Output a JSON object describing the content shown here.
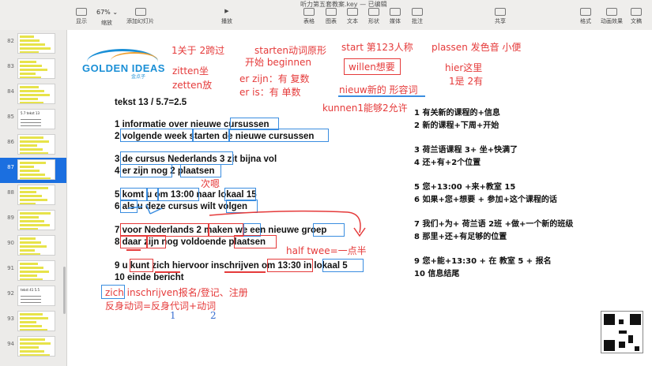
{
  "toolbar": {
    "title": "听力第五套教案.key — 已编辑",
    "zoom": "67%",
    "items": [
      {
        "label": "显示",
        "icon": "sidebar-icon"
      },
      {
        "label": "缩放",
        "icon": "zoom-icon"
      },
      {
        "label": "添加幻灯片",
        "icon": "add-slide-icon"
      },
      {
        "label": "播放",
        "icon": "play-icon"
      },
      {
        "label": "表格",
        "icon": "table-icon"
      },
      {
        "label": "图表",
        "icon": "chart-icon"
      },
      {
        "label": "文本",
        "icon": "text-icon"
      },
      {
        "label": "形状",
        "icon": "shape-icon"
      },
      {
        "label": "媒体",
        "icon": "media-icon"
      },
      {
        "label": "批注",
        "icon": "comment-icon"
      },
      {
        "label": "共享",
        "icon": "share-icon"
      },
      {
        "label": "格式",
        "icon": "format-icon"
      },
      {
        "label": "动画效果",
        "icon": "animate-icon"
      },
      {
        "label": "文稿",
        "icon": "document-icon"
      }
    ]
  },
  "sidebar": {
    "slides": [
      {
        "num": "82"
      },
      {
        "num": "83"
      },
      {
        "num": "84"
      },
      {
        "num": "85"
      },
      {
        "num": "86"
      },
      {
        "num": "87"
      },
      {
        "num": "88"
      },
      {
        "num": "89"
      },
      {
        "num": "90"
      },
      {
        "num": "91"
      },
      {
        "num": "92"
      },
      {
        "num": "93"
      },
      {
        "num": "94"
      }
    ],
    "thumb_texts": {
      "85": "5.7 tekst 13",
      "92": "tekst 41 5.5"
    },
    "active": "87"
  },
  "slide": {
    "logo": {
      "brand": "GOLDEN IDEAS",
      "sub": "金点子"
    },
    "title": "tekst 13 / 5.7=2.5",
    "lines": [
      "1 informatie over nieuwe cursussen",
      "2 volgende week starten de nieuwe cursussen",
      "3 de cursus Nederlands 3 zit bijna vol",
      "4 er zijn nog 2 plaatsen",
      "5 komt u om 13:00 naar lokaal 15",
      "6 als u deze cursus wilt volgen",
      "7 voor Nederlands 2 maken we een nieuwe groep",
      "8 daar zijn nog voldoende plaatsen",
      "9 u kunt zich hiervoor inschrijven om 13:30 in lokaal 5",
      "10  einde bericht"
    ],
    "translations": [
      "1 有关新的课程的+信息",
      "2 新的课程+下周+开始",
      "3 荷兰语课程 3+ 坐+快满了",
      "4 还+有+2个位置",
      "5 您+13:00 +来+教室 15",
      "6 如果+您+想要 + 参加+这个课程的话",
      "7 我们+为+ 荷兰语 2班 +做+一个新的班级",
      "8 那里+还+有足够的位置",
      "9 您+能+13:30 + 在 教室 5 + 报名",
      "10 信息结尾"
    ],
    "notes": {
      "n1": "1关于 2跨过",
      "n2": "starten动词原形",
      "n3": "开始 beginnen",
      "n4": "start 第123人称",
      "n5": "plassen 发色音 小便",
      "n6": "willen想要",
      "n7": "hier这里",
      "n8": "1是 2有",
      "n9": "zitten坐",
      "n10": "zetten放",
      "n11": "er zijn：有 复数",
      "n12": "er is：有 单数",
      "n13": "nieuw新的 形容词",
      "n14": "kunnen1能够2允许",
      "n15": "次嗯",
      "n16": "half twee=一点半",
      "n17": "zich inschrijven报名/登记、注册",
      "n18": "反身动词=反身代词+动词",
      "n19": "1",
      "n20": "2"
    }
  }
}
